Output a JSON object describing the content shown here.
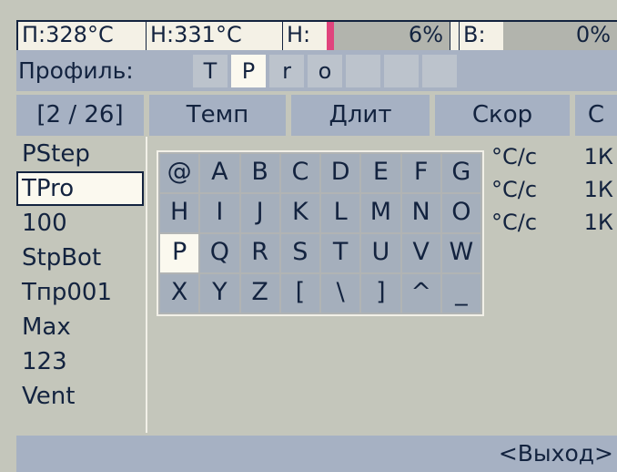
{
  "status": {
    "p_temp": "П:328°C",
    "h_temp": "Н:331°C",
    "h_label": "Н:",
    "h_value": "6%",
    "h_level": 0.06,
    "v_label": "В:",
    "v_value": "0%",
    "v_level": 0.0
  },
  "profile": {
    "label": "Профиль:",
    "slots": [
      "T",
      "P",
      "r",
      "o",
      "",
      "",
      ""
    ]
  },
  "header": {
    "counter": "[2 / 26]",
    "col_temp": "Темп",
    "col_dur": "Длит",
    "col_speed": "Скор",
    "col_extra": "С"
  },
  "list": [
    "PStep",
    "TPro",
    "100",
    "StpBot",
    "Тпр001",
    "Max",
    "123",
    "Vent"
  ],
  "rows": [
    {
      "unit": "°C/c",
      "extra": "1К"
    },
    {
      "unit": "°C/c",
      "extra": "1К"
    },
    {
      "unit": "°C/c",
      "extra": "1К"
    }
  ],
  "keyboard": [
    "@",
    "A",
    "B",
    "C",
    "D",
    "E",
    "F",
    "G",
    "H",
    "I",
    "J",
    "K",
    "L",
    "M",
    "N",
    "O",
    "P",
    "Q",
    "R",
    "S",
    "T",
    "U",
    "V",
    "W",
    "X",
    "Y",
    "Z",
    "[",
    "\\",
    "]",
    "^",
    "_"
  ],
  "footer": {
    "exit": "<Выход>"
  },
  "colors": {
    "accent": "#e0447d",
    "panel": "#a6b1c3",
    "highlight": "#fbf9ef",
    "text": "#13233f"
  }
}
